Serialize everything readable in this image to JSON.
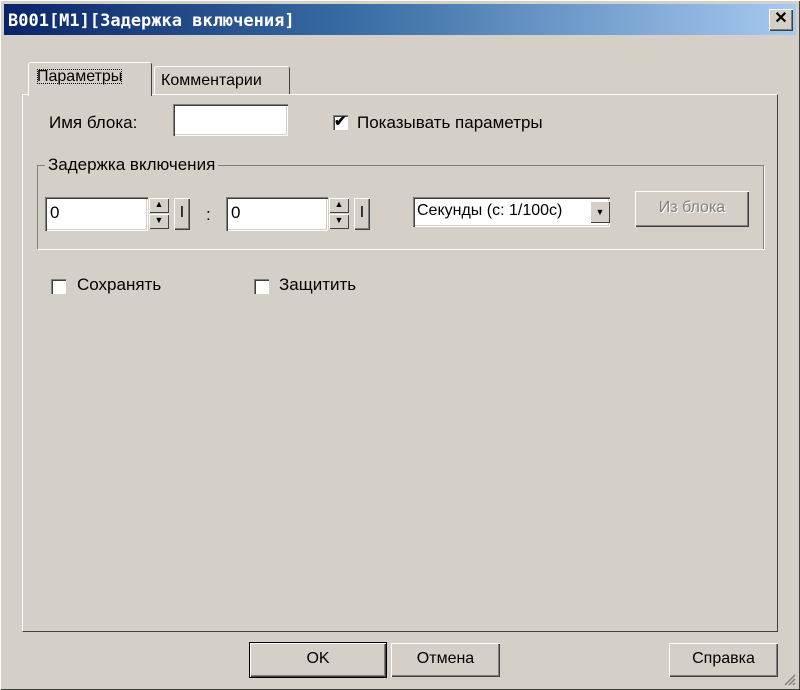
{
  "window": {
    "title": "B001[M1][Задержка включения]",
    "close_glyph": "✕"
  },
  "tabs": [
    {
      "label": "Параметры",
      "active": true
    },
    {
      "label": "Комментарии",
      "active": false
    }
  ],
  "block_name": {
    "label": "Имя блока:",
    "value": ""
  },
  "show_params": {
    "label": "Показывать параметры",
    "checked": true,
    "mark": "✔"
  },
  "delay_group": {
    "title": "Задержка включения",
    "field1": {
      "value": "0",
      "spin_up": "▲",
      "spin_down": "▼",
      "i_label": "I"
    },
    "separator": ":",
    "field2": {
      "value": "0",
      "spin_up": "▲",
      "spin_down": "▼",
      "i_label": "I"
    },
    "units": {
      "value": "Секунды (с: 1/100с)",
      "arrow": "▼"
    },
    "from_block_label": "Из блока"
  },
  "options": {
    "save": {
      "label": "Сохранять",
      "checked": false
    },
    "protect": {
      "label": "Защитить",
      "checked": false
    }
  },
  "buttons": {
    "ok": "OK",
    "cancel": "Отмена",
    "help": "Справка"
  },
  "icons": {
    "close": "close-icon",
    "checkmark": "checkmark-icon",
    "spin": "spin-arrow-icon",
    "dropdown": "chevron-down-icon",
    "grip": "resize-grip-icon"
  }
}
